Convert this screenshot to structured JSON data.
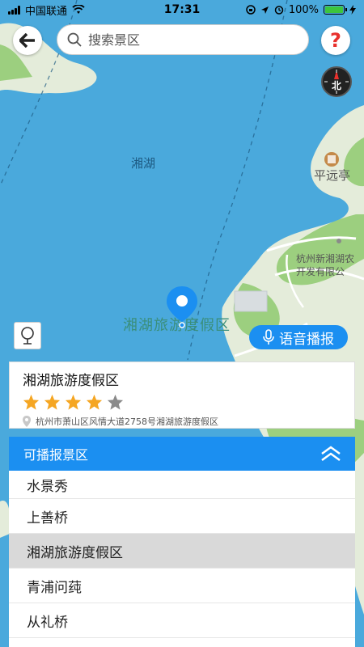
{
  "status": {
    "carrier": "中国联通",
    "time": "17:31",
    "battery": "100%"
  },
  "search": {
    "placeholder": "搜索景区"
  },
  "help_label": "?",
  "compass_label": "北",
  "map_labels": {
    "lake": "湘湖",
    "pavilion": "平远亭",
    "company_line1": "杭州新湘湖农",
    "company_line2": "开发有限公",
    "resort": "湘湖旅游度假区"
  },
  "voice_button": "语音播报",
  "info": {
    "title": "湘湖旅游度假区",
    "rating": 4,
    "rating_max": 5,
    "address": "杭州市萧山区风情大道2758号湘湖旅游度假区"
  },
  "panel": {
    "title": "可播报景区",
    "items": [
      "水景秀",
      "上善桥",
      "湘湖旅游度假区",
      "青浦问莼",
      "从礼桥"
    ],
    "selected_index": 2
  },
  "colors": {
    "accent": "#1b8ff1",
    "water": "#4aa9dc",
    "land": "#e4ecda",
    "star_on": "#f5a623",
    "star_off": "#8a8a8a"
  }
}
